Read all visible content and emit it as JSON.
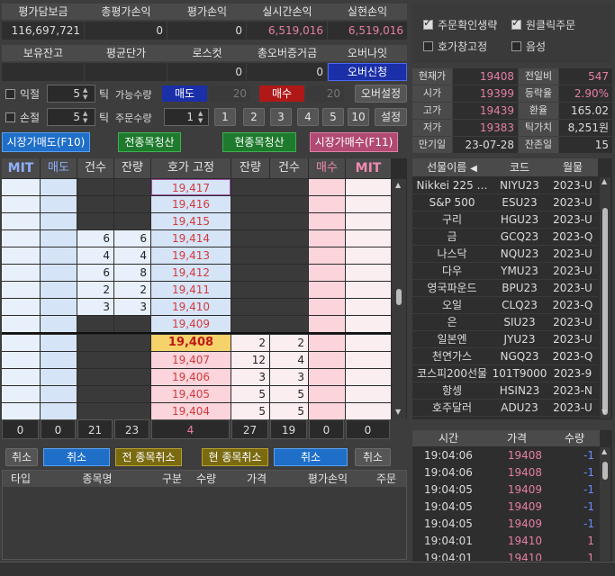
{
  "summary": {
    "headers": [
      "평가담보금",
      "총평가손익",
      "평가손익",
      "실시간손익",
      "실현손익"
    ],
    "values": [
      "116,697,721",
      "0",
      "0",
      "6,519,016",
      "6,519,016"
    ],
    "headers2": [
      "보유잔고",
      "평균단가",
      "로스컷",
      "총오버증거금",
      "오버나잇"
    ],
    "values2": [
      "",
      "",
      "0",
      "0"
    ],
    "overnight_btn": "오버신청"
  },
  "options": {
    "profit_label": "익절",
    "profit_val": "5",
    "loss_label": "손절",
    "loss_val": "5",
    "tick": "틱",
    "avail_qty": "가능수량",
    "sell_tag": "매도",
    "sell_avail": "20",
    "buy_tag": "매수",
    "buy_avail": "20",
    "over_settings": "오버설정",
    "order_qty": "주문수량",
    "order_qty_val": "1",
    "qty_buttons": [
      "1",
      "2",
      "3",
      "4",
      "5",
      "10"
    ],
    "settings": "설정"
  },
  "actions": {
    "market_sell": "시장가매도(F10)",
    "clear_all": "전종목청산",
    "clear_cur": "현종목청산",
    "market_buy": "시장가매수(F11)"
  },
  "checks": {
    "auto_confirm": "주문확인생략",
    "one_click": "원클릭주문",
    "fix_price": "호가창고정",
    "sound": "음성"
  },
  "quote": {
    "rows": [
      {
        "l1": "현재가",
        "v1": "19408",
        "l2": "전일비",
        "v2": "547"
      },
      {
        "l1": "시가",
        "v1": "19399",
        "l2": "등락율",
        "v2": "2.90%"
      },
      {
        "l1": "고가",
        "v1": "19439",
        "l2": "환율",
        "v2": "165.02"
      },
      {
        "l1": "저가",
        "v1": "19383",
        "l2": "틱가치",
        "v2": "8,251원"
      },
      {
        "l1": "만기일",
        "v1": "23-07-28",
        "l2": "잔존일",
        "v2": "15"
      }
    ]
  },
  "orderbook": {
    "headers": [
      "MIT",
      "매도",
      "건수",
      "잔량",
      "호가 고정",
      "잔량",
      "건수",
      "매수",
      "MIT"
    ],
    "asks": [
      {
        "price": "19,417",
        "cnt": "",
        "qty": ""
      },
      {
        "price": "19,416",
        "cnt": "",
        "qty": ""
      },
      {
        "price": "19,415",
        "cnt": "",
        "qty": ""
      },
      {
        "price": "19,414",
        "cnt": "6",
        "qty": "6"
      },
      {
        "price": "19,413",
        "cnt": "4",
        "qty": "4"
      },
      {
        "price": "19,412",
        "cnt": "6",
        "qty": "8"
      },
      {
        "price": "19,411",
        "cnt": "2",
        "qty": "2"
      },
      {
        "price": "19,410",
        "cnt": "3",
        "qty": "3"
      },
      {
        "price": "19,409",
        "cnt": "",
        "qty": ""
      }
    ],
    "bids": [
      {
        "price": "19,408",
        "qty": "2",
        "cnt": "2"
      },
      {
        "price": "19,407",
        "qty": "12",
        "cnt": "4"
      },
      {
        "price": "19,406",
        "qty": "3",
        "cnt": "3"
      },
      {
        "price": "19,405",
        "qty": "5",
        "cnt": "5"
      },
      {
        "price": "19,404",
        "qty": "5",
        "cnt": "5"
      }
    ],
    "totals": [
      "0",
      "0",
      "21",
      "23",
      "4",
      "27",
      "19",
      "0",
      "0"
    ],
    "cancel_btns": [
      "취소",
      "취소",
      "전 종목취소",
      "현 종목취소",
      "취소",
      "취소"
    ]
  },
  "positions": {
    "headers": [
      "타입",
      "종목명",
      "구분",
      "수량",
      "가격",
      "평가손익",
      "주문"
    ]
  },
  "futures": {
    "headers": [
      "선물이름",
      "코드",
      "월물"
    ],
    "rows": [
      {
        "name": "Nikkei 225 …",
        "code": "NIYU23",
        "month": "2023-U"
      },
      {
        "name": "S&P 500",
        "code": "ESU23",
        "month": "2023-U"
      },
      {
        "name": "구리",
        "code": "HGU23",
        "month": "2023-U"
      },
      {
        "name": "금",
        "code": "GCQ23",
        "month": "2023-Q"
      },
      {
        "name": "나스닥",
        "code": "NQU23",
        "month": "2023-U"
      },
      {
        "name": "다우",
        "code": "YMU23",
        "month": "2023-U"
      },
      {
        "name": "영국파운드",
        "code": "BPU23",
        "month": "2023-U"
      },
      {
        "name": "오일",
        "code": "CLQ23",
        "month": "2023-Q"
      },
      {
        "name": "은",
        "code": "SIU23",
        "month": "2023-U"
      },
      {
        "name": "일본엔",
        "code": "JYU23",
        "month": "2023-U"
      },
      {
        "name": "천연가스",
        "code": "NGQ23",
        "month": "2023-Q"
      },
      {
        "name": "코스피200선물",
        "code": "101T9000",
        "month": "2023-9"
      },
      {
        "name": "항셍",
        "code": "HSIN23",
        "month": "2023-N"
      },
      {
        "name": "호주달러",
        "code": "ADU23",
        "month": "2023-U"
      }
    ]
  },
  "trades": {
    "headers": [
      "시간",
      "가격",
      "수량"
    ],
    "rows": [
      {
        "time": "19:04:06",
        "price": "19408",
        "qty": "-1"
      },
      {
        "time": "19:04:06",
        "price": "19408",
        "qty": "-1"
      },
      {
        "time": "19:04:05",
        "price": "19409",
        "qty": "-1"
      },
      {
        "time": "19:04:05",
        "price": "19409",
        "qty": "-1"
      },
      {
        "time": "19:04:05",
        "price": "19409",
        "qty": "-1"
      },
      {
        "time": "19:04:01",
        "price": "19410",
        "qty": "1"
      },
      {
        "time": "19:04:01",
        "price": "19410",
        "qty": "1"
      }
    ]
  }
}
